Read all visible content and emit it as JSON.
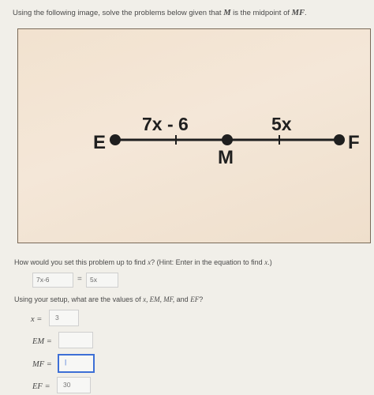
{
  "instructions": {
    "prefix": "Using the following image, solve the problems below given that ",
    "M": "M",
    "middle": " is the midpoint of ",
    "MF": "MF",
    "suffix": "."
  },
  "diagram": {
    "point_left": "E",
    "point_mid": "M",
    "point_right": "F",
    "segment_left_label": "7x - 6",
    "segment_right_label": "5x",
    "line_color": "#1f1f1f"
  },
  "setup": {
    "question_prefix": "How would you set this problem up to find ",
    "question_var": "x",
    "question_hint": "? (Hint: Enter in the equation to find ",
    "question_end": ".)",
    "left_value": "7x-6",
    "equals": "=",
    "right_value": "5x"
  },
  "values": {
    "question_prefix": "Using your setup, what are the values of ",
    "question_vars": "x, EM, MF,",
    "question_and": " and ",
    "question_ef": "EF",
    "question_end": "?",
    "x_label": "x =",
    "x_value": "3",
    "em_label": "EM =",
    "em_value": "",
    "mf_label": "MF =",
    "mf_value": "|",
    "ef_label": "EF =",
    "ef_value": "30"
  },
  "colors": {
    "accent": "#3d6fd6"
  }
}
